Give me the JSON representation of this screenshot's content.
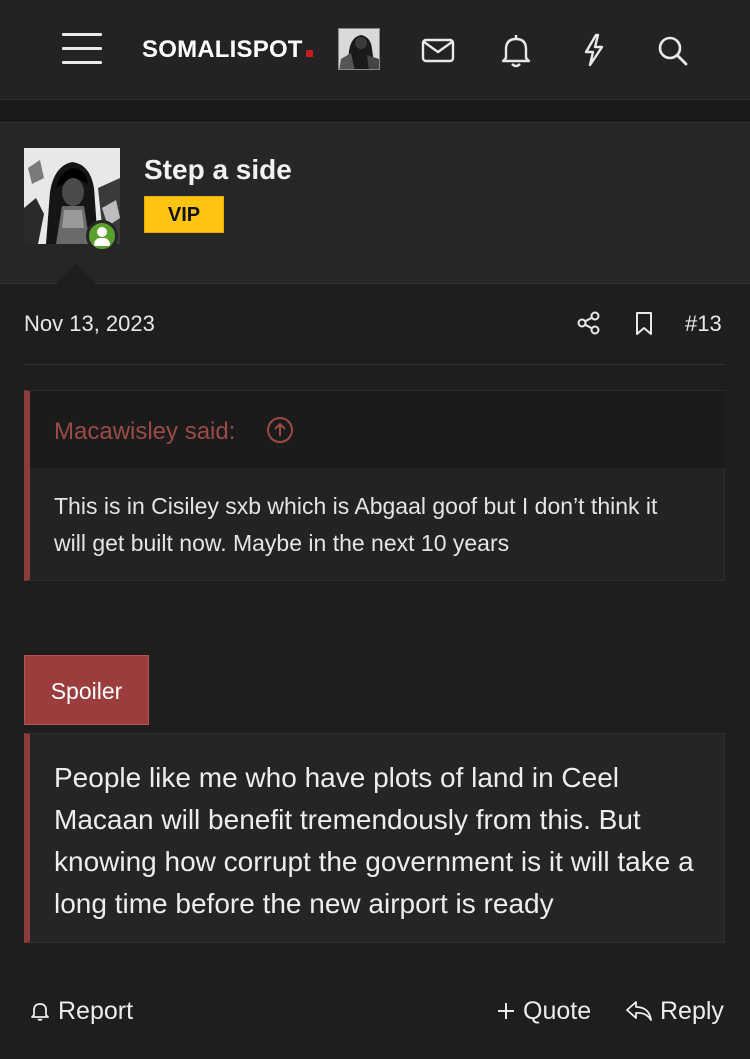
{
  "header": {
    "logo_text": "SOMALISPOT",
    "logo_accent_color": "#c0211f",
    "icons": [
      "menu-icon",
      "mail-icon",
      "bell-icon",
      "lightning-icon",
      "search-icon"
    ]
  },
  "post": {
    "username": "Step a side",
    "badge": "VIP",
    "badge_color": "#fec410",
    "online_status_color": "#5aa02c",
    "date": "Nov 13, 2023",
    "post_number": "#13",
    "quote": {
      "author": "Macawisley said:",
      "text": "This is in Cisiley sxb which is Abgaal goof but I don’t think it will get built now. Maybe in the next 10 years"
    },
    "spoiler": {
      "button_label": "Spoiler",
      "text": "People like me who have plots of land in Ceel Macaan will benefit tremendously from this. But knowing how corrupt the government is it will take a long time before the new airport is ready"
    },
    "actions": {
      "report": "Report",
      "quote": "Quote",
      "reply": "Reply"
    }
  },
  "colors": {
    "background": "#1e1e1f",
    "quote_accent": "#8e3b3b",
    "spoiler_button": "#9a3d3c"
  }
}
